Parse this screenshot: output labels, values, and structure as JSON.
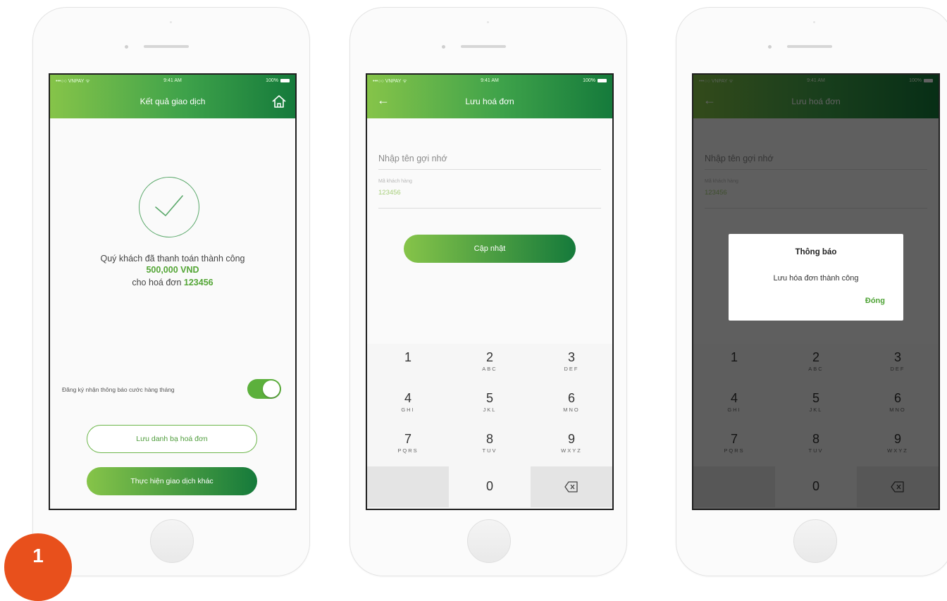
{
  "status_bar": {
    "carrier": "•••○○ VNPAY ᯤ",
    "time": "9:41 AM",
    "battery": "100%"
  },
  "screen1": {
    "title": "Kết quả giao dịch",
    "success_line": "Quý khách đã thanh toán thành công",
    "amount": "500,000 VND",
    "bill_prefix": "cho hoá đơn",
    "bill_number": "123456",
    "toggle_label": "Đăng ký nhận thông báo cước hàng tháng",
    "toggle_on": true,
    "save_button": "Lưu danh bạ hoá đơn",
    "other_tx_button": "Thực hiện giao dịch khác"
  },
  "screen2": {
    "title": "Lưu hoá đơn",
    "name_placeholder": "Nhập tên gợi nhớ",
    "code_label": "Mã khách hàng",
    "code_value": "123456",
    "update_button": "Cập nhật"
  },
  "keypad": [
    {
      "num": "1",
      "letters": ""
    },
    {
      "num": "2",
      "letters": "ABC"
    },
    {
      "num": "3",
      "letters": "DEF"
    },
    {
      "num": "4",
      "letters": "GHI"
    },
    {
      "num": "5",
      "letters": "JKL"
    },
    {
      "num": "6",
      "letters": "MNO"
    },
    {
      "num": "7",
      "letters": "PQRS"
    },
    {
      "num": "8",
      "letters": "TUV"
    },
    {
      "num": "9",
      "letters": "WXYZ"
    },
    {
      "num": "0",
      "letters": ""
    }
  ],
  "screen3": {
    "dialog_title": "Thông báo",
    "dialog_message": "Lưu hóa đơn thành công",
    "dialog_button": "Đóng"
  },
  "step_badge": "1",
  "colors": {
    "accent": "#5cb03c",
    "header_start": "#86c449",
    "header_end": "#157a3b",
    "badge": "#e8501c"
  },
  "icons": [
    "home-icon",
    "back-arrow-icon",
    "check-icon",
    "backspace-icon"
  ]
}
